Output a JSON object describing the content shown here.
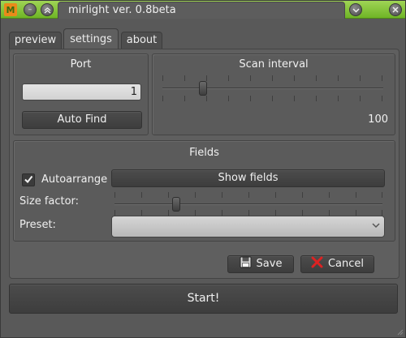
{
  "window": {
    "title": "mirlight ver. 0.8beta",
    "logo_glyph": "M",
    "accent_color": "#7cc233"
  },
  "titlebar_icons": [
    "app-logo-icon",
    "minimize-icon",
    "shade-icon",
    "menu-chevron-down-icon",
    "close-icon"
  ],
  "tabs": [
    {
      "label": "preview"
    },
    {
      "label": "settings"
    },
    {
      "label": "about"
    }
  ],
  "port": {
    "title": "Port",
    "value": "1",
    "auto_find_label": "Auto Find"
  },
  "scan_interval": {
    "title": "Scan interval",
    "value_text": "100"
  },
  "fields": {
    "title": "Fields",
    "autoarrange_label": "Autoarrange",
    "autoarrange_checked": true,
    "show_fields_label": "Show fields",
    "size_factor_label": "Size factor:",
    "preset_label": "Preset:",
    "preset_value": ""
  },
  "actions": {
    "save_label": "Save",
    "cancel_label": "Cancel",
    "start_label": "Start!"
  }
}
